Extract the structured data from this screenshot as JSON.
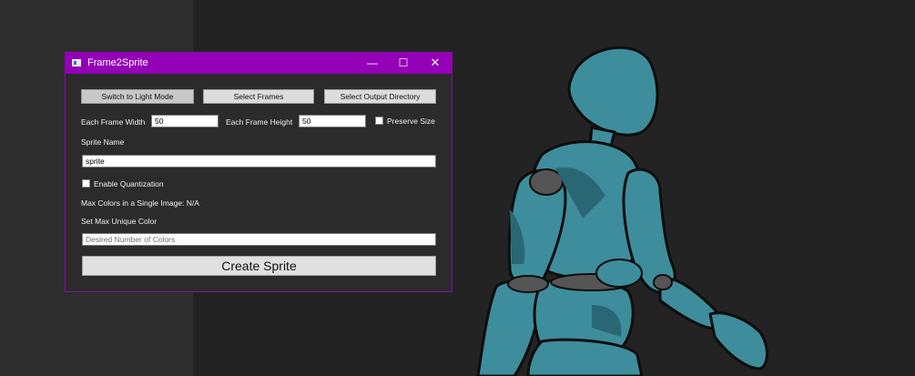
{
  "window": {
    "title": "Frame2Sprite",
    "minimize_glyph": "—",
    "maximize_glyph": "☐",
    "close_glyph": "✕"
  },
  "toolbar": {
    "theme_button": "Switch to Light Mode",
    "select_frames_button": "Select Frames",
    "select_output_button": "Select Output Directory"
  },
  "frame_size": {
    "width_label": "Each Frame Width",
    "width_value": "50",
    "height_label": "Each Frame Height",
    "height_value": "50",
    "preserve_label": "Preserve Size",
    "preserve_checked": false
  },
  "sprite": {
    "name_label": "Sprite Name",
    "name_value": "sprite"
  },
  "quantization": {
    "enable_label": "Enable Quantization",
    "enabled": false,
    "max_colors_text": "Max Colors in a Single Image: N/A",
    "set_max_label": "Set Max Unique Color",
    "colors_placeholder": "Desired Number of Colors"
  },
  "actions": {
    "create_label": "Create Sprite"
  },
  "colors": {
    "titlebar": "#9400b8",
    "window_bg": "#2b2b2b",
    "figure_teal": "#3d8d9c"
  }
}
